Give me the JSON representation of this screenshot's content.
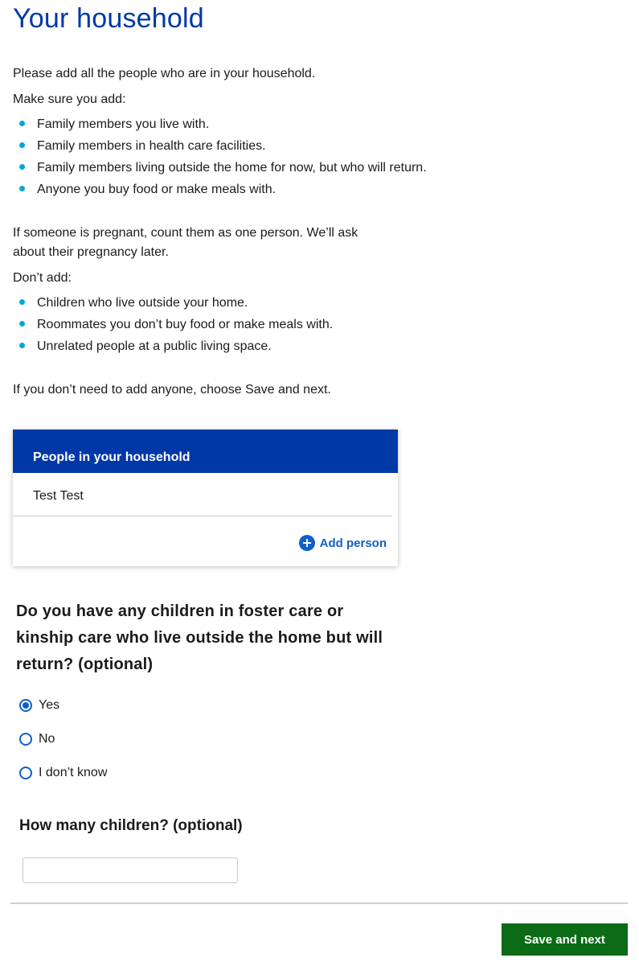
{
  "page": {
    "title": "Your household"
  },
  "intro": {
    "line1": "Please add all the people who are in your household.",
    "make_sure": "Make sure you add:",
    "add_items": [
      "Family members you live with.",
      "Family members in health care facilities.",
      "Family members living outside the home for now, but who will return.",
      "Anyone you buy food or make meals with."
    ],
    "pregnant": "If someone is pregnant, count them as one person. We’ll ask about their pregnancy later.",
    "dont_add": "Don’t add:",
    "dont_items": [
      "Children who live outside your home.",
      "Roommates you don’t buy food or make meals with.",
      "Unrelated people at a public living space."
    ],
    "no_add": "If you don’t need to add anyone, choose Save and next."
  },
  "household_card": {
    "header": "People in your household",
    "people": [
      "Test Test"
    ],
    "add_label": "Add person"
  },
  "foster_question": {
    "label": "Do you have any children in foster care or kinship care who live outside the home but will return? (optional)",
    "options": [
      "Yes",
      "No",
      "I don’t know"
    ],
    "selected": "Yes"
  },
  "children_count": {
    "label": "How many children? (optional)",
    "value": ""
  },
  "footer": {
    "save_label": "Save and next"
  },
  "colors": {
    "title": "#0038a8",
    "card_header": "#0038a8",
    "link": "#0f5fcc",
    "bullet": "#00a6d6",
    "save_button": "#0b6b16"
  }
}
